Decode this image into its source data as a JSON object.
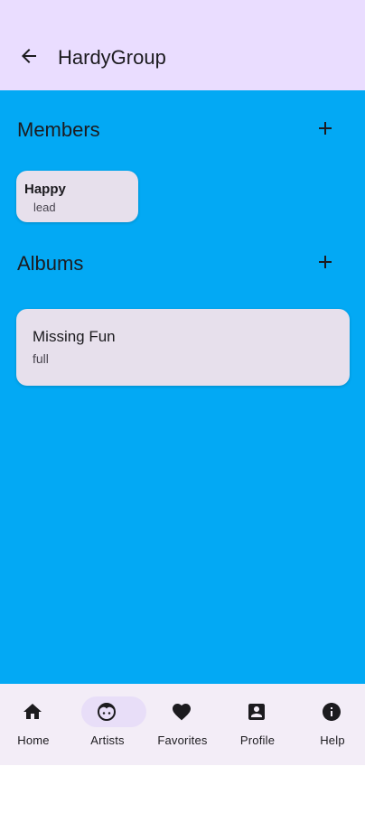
{
  "top_bar": {
    "title": "HardyGroup",
    "back_icon": "arrow-back-icon"
  },
  "members": {
    "title": "Members",
    "add_icon": "plus-icon",
    "items": [
      {
        "name": "Happy",
        "role": "lead"
      }
    ]
  },
  "albums": {
    "title": "Albums",
    "add_icon": "plus-icon",
    "items": [
      {
        "title": "Missing Fun",
        "type": "full"
      }
    ]
  },
  "bottom_nav": {
    "items": [
      {
        "label": "Home",
        "icon": "home-icon",
        "active": false
      },
      {
        "label": "Artists",
        "icon": "face-icon",
        "active": true
      },
      {
        "label": "Favorites",
        "icon": "heart-icon",
        "active": false
      },
      {
        "label": "Profile",
        "icon": "profile-icon",
        "active": false
      },
      {
        "label": "Help",
        "icon": "info-icon",
        "active": false
      }
    ]
  },
  "colors": {
    "top_bar_bg": "#eaddff",
    "content_bg": "#03a9f4",
    "card_bg": "#e7e0ec",
    "nav_bg": "#f3edf7",
    "nav_active_indicator": "#e8def8"
  }
}
